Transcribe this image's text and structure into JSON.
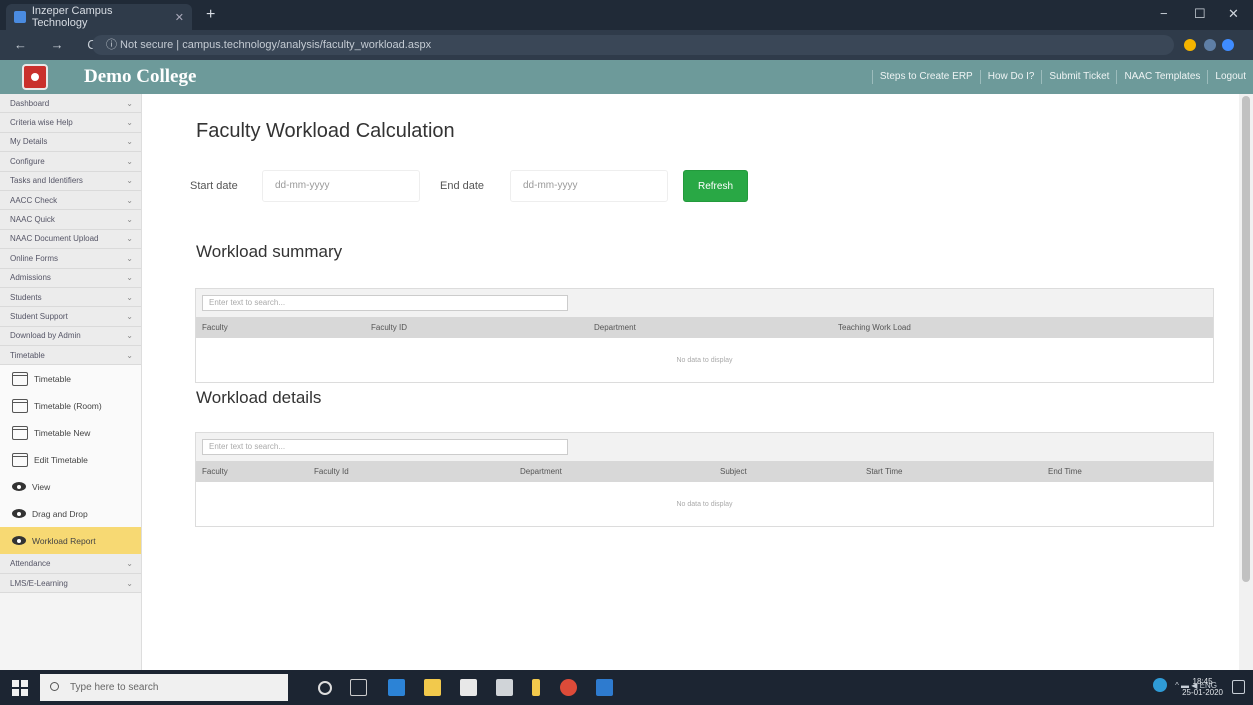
{
  "browser": {
    "tab_title": "Inzeper Campus Technology",
    "new_tab_glyph": "+",
    "nav_glyphs": "← → C",
    "url": "ⓘ Not secure | campus.technology/analysis/faculty_workload.aspx",
    "window_controls": {
      "minimize": "−",
      "maximize": "☐",
      "close": "✕"
    }
  },
  "app": {
    "name": "Demo College",
    "top_links": [
      "Steps to Create ERP",
      "How Do I?",
      "Submit Ticket",
      "NAAC Templates",
      "Logout"
    ]
  },
  "sidebar": {
    "menu": [
      "Dashboard",
      "Criteria wise Help",
      "My Details",
      "Configure",
      "Tasks and Identifiers",
      "AACC Check",
      "NAAC Quick",
      "NAAC Document Upload",
      "Online Forms",
      "Admissions",
      "Students",
      "Student Support",
      "Download by Admin",
      "Timetable"
    ],
    "submenu": [
      {
        "label": "Timetable",
        "icon": "calendar-icon",
        "active": false
      },
      {
        "label": "Timetable (Room)",
        "icon": "calendar-icon",
        "active": false
      },
      {
        "label": "Timetable New",
        "icon": "calendar-icon",
        "active": false
      },
      {
        "label": "Edit Timetable",
        "icon": "calendar-icon",
        "active": false
      },
      {
        "label": "View",
        "icon": "eye-icon",
        "active": false
      },
      {
        "label": "Drag and Drop",
        "icon": "eye-icon",
        "active": false
      },
      {
        "label": "Workload Report",
        "icon": "eye-icon",
        "active": true
      }
    ],
    "menu_after": [
      "Attendance",
      "LMS/E-Learning"
    ],
    "chevron": "⌄"
  },
  "main": {
    "title": "Faculty Workload Calculation",
    "start_label": "Start date",
    "start_placeholder": "dd-mm-yyyy",
    "end_label": "End date",
    "end_placeholder": "dd-mm-yyyy",
    "refresh_label": "Refresh",
    "summary": {
      "title": "Workload summary",
      "search_placeholder": "Enter text to search...",
      "columns": [
        "Faculty",
        "Faculty ID",
        "Department",
        "Teaching Work Load"
      ],
      "empty": "No data to display"
    },
    "details": {
      "title": "Workload details",
      "search_placeholder": "Enter text to search...",
      "columns": [
        "Faculty",
        "Faculty Id",
        "Department",
        "Subject",
        "Start Time",
        "End Time"
      ],
      "empty": "No data to display"
    }
  },
  "taskbar": {
    "search_placeholder": "Type here to search",
    "tray_text": "^ ▬ ◀ ENG",
    "time": "18:45",
    "date": "25-01-2020"
  }
}
